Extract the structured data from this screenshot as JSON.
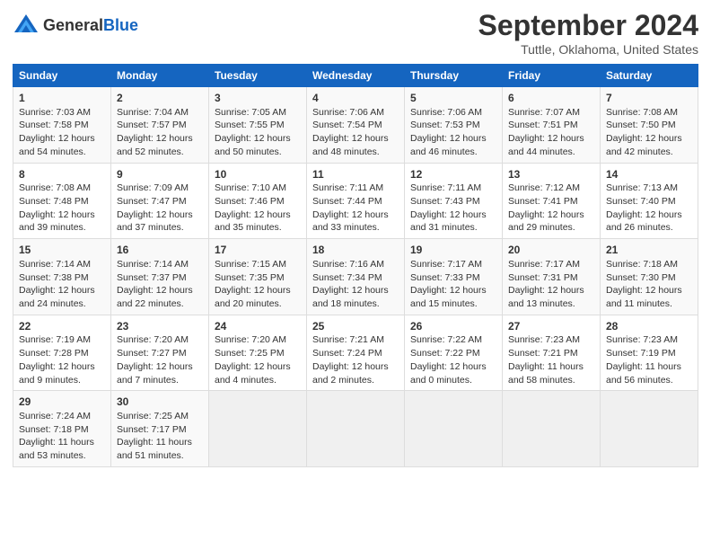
{
  "header": {
    "logo_line1": "General",
    "logo_line2": "Blue",
    "main_title": "September 2024",
    "sub_title": "Tuttle, Oklahoma, United States"
  },
  "columns": [
    "Sunday",
    "Monday",
    "Tuesday",
    "Wednesday",
    "Thursday",
    "Friday",
    "Saturday"
  ],
  "weeks": [
    [
      {
        "day": "1",
        "lines": [
          "Sunrise: 7:03 AM",
          "Sunset: 7:58 PM",
          "Daylight: 12 hours",
          "and 54 minutes."
        ]
      },
      {
        "day": "2",
        "lines": [
          "Sunrise: 7:04 AM",
          "Sunset: 7:57 PM",
          "Daylight: 12 hours",
          "and 52 minutes."
        ]
      },
      {
        "day": "3",
        "lines": [
          "Sunrise: 7:05 AM",
          "Sunset: 7:55 PM",
          "Daylight: 12 hours",
          "and 50 minutes."
        ]
      },
      {
        "day": "4",
        "lines": [
          "Sunrise: 7:06 AM",
          "Sunset: 7:54 PM",
          "Daylight: 12 hours",
          "and 48 minutes."
        ]
      },
      {
        "day": "5",
        "lines": [
          "Sunrise: 7:06 AM",
          "Sunset: 7:53 PM",
          "Daylight: 12 hours",
          "and 46 minutes."
        ]
      },
      {
        "day": "6",
        "lines": [
          "Sunrise: 7:07 AM",
          "Sunset: 7:51 PM",
          "Daylight: 12 hours",
          "and 44 minutes."
        ]
      },
      {
        "day": "7",
        "lines": [
          "Sunrise: 7:08 AM",
          "Sunset: 7:50 PM",
          "Daylight: 12 hours",
          "and 42 minutes."
        ]
      }
    ],
    [
      {
        "day": "8",
        "lines": [
          "Sunrise: 7:08 AM",
          "Sunset: 7:48 PM",
          "Daylight: 12 hours",
          "and 39 minutes."
        ]
      },
      {
        "day": "9",
        "lines": [
          "Sunrise: 7:09 AM",
          "Sunset: 7:47 PM",
          "Daylight: 12 hours",
          "and 37 minutes."
        ]
      },
      {
        "day": "10",
        "lines": [
          "Sunrise: 7:10 AM",
          "Sunset: 7:46 PM",
          "Daylight: 12 hours",
          "and 35 minutes."
        ]
      },
      {
        "day": "11",
        "lines": [
          "Sunrise: 7:11 AM",
          "Sunset: 7:44 PM",
          "Daylight: 12 hours",
          "and 33 minutes."
        ]
      },
      {
        "day": "12",
        "lines": [
          "Sunrise: 7:11 AM",
          "Sunset: 7:43 PM",
          "Daylight: 12 hours",
          "and 31 minutes."
        ]
      },
      {
        "day": "13",
        "lines": [
          "Sunrise: 7:12 AM",
          "Sunset: 7:41 PM",
          "Daylight: 12 hours",
          "and 29 minutes."
        ]
      },
      {
        "day": "14",
        "lines": [
          "Sunrise: 7:13 AM",
          "Sunset: 7:40 PM",
          "Daylight: 12 hours",
          "and 26 minutes."
        ]
      }
    ],
    [
      {
        "day": "15",
        "lines": [
          "Sunrise: 7:14 AM",
          "Sunset: 7:38 PM",
          "Daylight: 12 hours",
          "and 24 minutes."
        ]
      },
      {
        "day": "16",
        "lines": [
          "Sunrise: 7:14 AM",
          "Sunset: 7:37 PM",
          "Daylight: 12 hours",
          "and 22 minutes."
        ]
      },
      {
        "day": "17",
        "lines": [
          "Sunrise: 7:15 AM",
          "Sunset: 7:35 PM",
          "Daylight: 12 hours",
          "and 20 minutes."
        ]
      },
      {
        "day": "18",
        "lines": [
          "Sunrise: 7:16 AM",
          "Sunset: 7:34 PM",
          "Daylight: 12 hours",
          "and 18 minutes."
        ]
      },
      {
        "day": "19",
        "lines": [
          "Sunrise: 7:17 AM",
          "Sunset: 7:33 PM",
          "Daylight: 12 hours",
          "and 15 minutes."
        ]
      },
      {
        "day": "20",
        "lines": [
          "Sunrise: 7:17 AM",
          "Sunset: 7:31 PM",
          "Daylight: 12 hours",
          "and 13 minutes."
        ]
      },
      {
        "day": "21",
        "lines": [
          "Sunrise: 7:18 AM",
          "Sunset: 7:30 PM",
          "Daylight: 12 hours",
          "and 11 minutes."
        ]
      }
    ],
    [
      {
        "day": "22",
        "lines": [
          "Sunrise: 7:19 AM",
          "Sunset: 7:28 PM",
          "Daylight: 12 hours",
          "and 9 minutes."
        ]
      },
      {
        "day": "23",
        "lines": [
          "Sunrise: 7:20 AM",
          "Sunset: 7:27 PM",
          "Daylight: 12 hours",
          "and 7 minutes."
        ]
      },
      {
        "day": "24",
        "lines": [
          "Sunrise: 7:20 AM",
          "Sunset: 7:25 PM",
          "Daylight: 12 hours",
          "and 4 minutes."
        ]
      },
      {
        "day": "25",
        "lines": [
          "Sunrise: 7:21 AM",
          "Sunset: 7:24 PM",
          "Daylight: 12 hours",
          "and 2 minutes."
        ]
      },
      {
        "day": "26",
        "lines": [
          "Sunrise: 7:22 AM",
          "Sunset: 7:22 PM",
          "Daylight: 12 hours",
          "and 0 minutes."
        ]
      },
      {
        "day": "27",
        "lines": [
          "Sunrise: 7:23 AM",
          "Sunset: 7:21 PM",
          "Daylight: 11 hours",
          "and 58 minutes."
        ]
      },
      {
        "day": "28",
        "lines": [
          "Sunrise: 7:23 AM",
          "Sunset: 7:19 PM",
          "Daylight: 11 hours",
          "and 56 minutes."
        ]
      }
    ],
    [
      {
        "day": "29",
        "lines": [
          "Sunrise: 7:24 AM",
          "Sunset: 7:18 PM",
          "Daylight: 11 hours",
          "and 53 minutes."
        ]
      },
      {
        "day": "30",
        "lines": [
          "Sunrise: 7:25 AM",
          "Sunset: 7:17 PM",
          "Daylight: 11 hours",
          "and 51 minutes."
        ]
      },
      {
        "day": "",
        "lines": []
      },
      {
        "day": "",
        "lines": []
      },
      {
        "day": "",
        "lines": []
      },
      {
        "day": "",
        "lines": []
      },
      {
        "day": "",
        "lines": []
      }
    ]
  ]
}
